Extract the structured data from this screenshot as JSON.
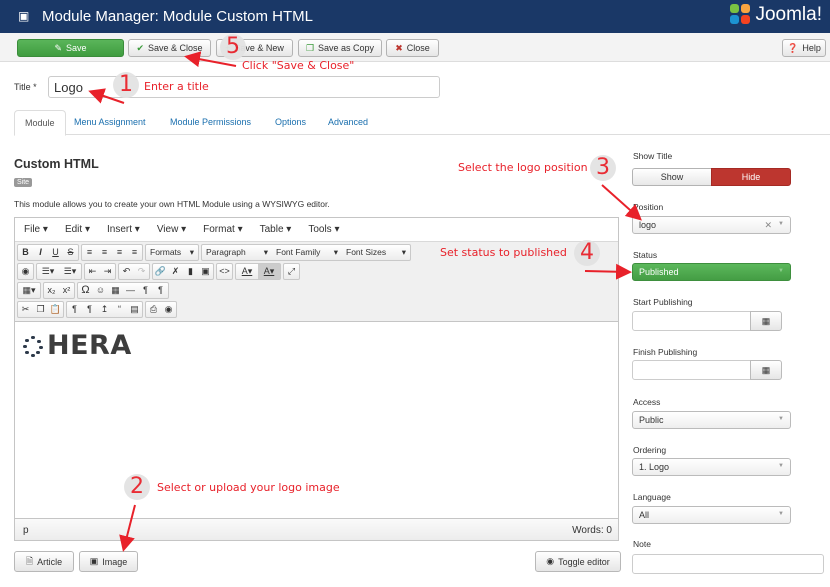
{
  "header": {
    "title": "Module Manager: Module Custom HTML",
    "brand": "Joomla!",
    "cube_icon": "cube-icon"
  },
  "toolbar": {
    "save": "Save",
    "save_close": "Save & Close",
    "save_new": "Save & New",
    "save_copy": "Save as Copy",
    "close": "Close",
    "help": "Help"
  },
  "form": {
    "title_label": "Title *",
    "title_value": "Logo"
  },
  "tabs": [
    "Module",
    "Menu Assignment",
    "Module Permissions",
    "Options",
    "Advanced"
  ],
  "module": {
    "heading": "Custom HTML",
    "badge": "Site",
    "description": "This module allows you to create your own HTML Module using a WYSIWYG editor."
  },
  "editor": {
    "menu": [
      "File",
      "Edit",
      "Insert",
      "View",
      "Format",
      "Table",
      "Tools"
    ],
    "dropdowns": {
      "formats": "Formats",
      "paragraph": "Paragraph",
      "font_family": "Font Family",
      "font_sizes": "Font Sizes"
    },
    "content_text": "HERA",
    "path": "p",
    "words": "Words: 0",
    "buttons": {
      "article": "Article",
      "image": "Image",
      "toggle": "Toggle editor"
    }
  },
  "sidebar": {
    "show_title_label": "Show Title",
    "show": "Show",
    "hide": "Hide",
    "position_label": "Position",
    "position_value": "logo",
    "status_label": "Status",
    "status_value": "Published",
    "start_label": "Start Publishing",
    "finish_label": "Finish Publishing",
    "access_label": "Access",
    "access_value": "Public",
    "ordering_label": "Ordering",
    "ordering_value": "1. Logo",
    "language_label": "Language",
    "language_value": "All",
    "note_label": "Note"
  },
  "annotations": {
    "step1_num": "1",
    "step1_text": "Enter a title",
    "step2_num": "2",
    "step2_text": "Select or upload your logo image",
    "step3_num": "3",
    "step3_text": "Select the logo position",
    "step4_num": "4",
    "step4_text": "Set status to published",
    "step5_num": "5",
    "step5_text": "Click \"Save & Close\""
  },
  "colors": {
    "header_bg": "#1a3867",
    "save_green": "#46a546",
    "hide_red": "#bd362f",
    "published_green": "#4cae4c",
    "annotation_red": "#e8212a",
    "link_blue": "#1a6fae"
  }
}
